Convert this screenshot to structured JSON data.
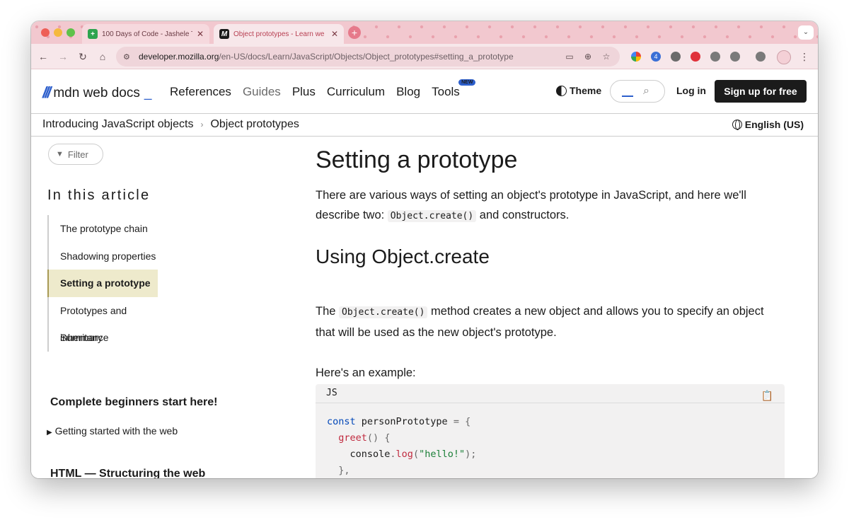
{
  "browser": {
    "tabs": [
      {
        "title": "100 Days of Code - Jashele T",
        "favicon": "plus-icon",
        "active": false
      },
      {
        "title": "Object prototypes - Learn we",
        "favicon": "mdn-icon",
        "active": true
      }
    ],
    "url_host": "developer.mozilla.org",
    "url_path": "/en-US/docs/Learn/JavaScript/Objects/Object_prototypes#setting_a_prototype",
    "extension_badge": "4"
  },
  "header": {
    "logo_text": "mdn web docs",
    "nav": [
      "References",
      "Guides",
      "Plus",
      "Curriculum",
      "Blog",
      "Tools"
    ],
    "new_badge": "NEW",
    "theme_label": "Theme",
    "login_label": "Log in",
    "signup_label": "Sign up for free"
  },
  "breadcrumb": {
    "items": [
      "Introducing JavaScript objects",
      "Object prototypes"
    ],
    "language": "English (US)"
  },
  "sidebar": {
    "filter_label": "Filter",
    "toc_heading": "In this article",
    "toc_items": [
      "The prototype chain",
      "Shadowing properties",
      "Setting a prototype",
      "Prototypes and inheritance",
      "Summary"
    ],
    "section1_heading": "Complete beginners start here!",
    "section1_item": "Getting started with the web",
    "section2_heading": "HTML — Structuring the web"
  },
  "content": {
    "h1": "Setting a prototype",
    "p1_before": "There are various ways of setting an object's prototype in JavaScript, and here we'll describe two: ",
    "p1_code": "Object.create()",
    "p1_after": " and constructors.",
    "h2": "Using Object.create",
    "p2_before": "The ",
    "p2_code": "Object.create()",
    "p2_after": " method creates a new object and allows you to specify an object that will be used as the new object's prototype.",
    "p3": "Here's an example:",
    "code_lang": "JS"
  },
  "colors": {
    "accent": "#2d5fcc",
    "tab_strip": "#f2c8cf",
    "toc_active": "#eeeacc"
  }
}
